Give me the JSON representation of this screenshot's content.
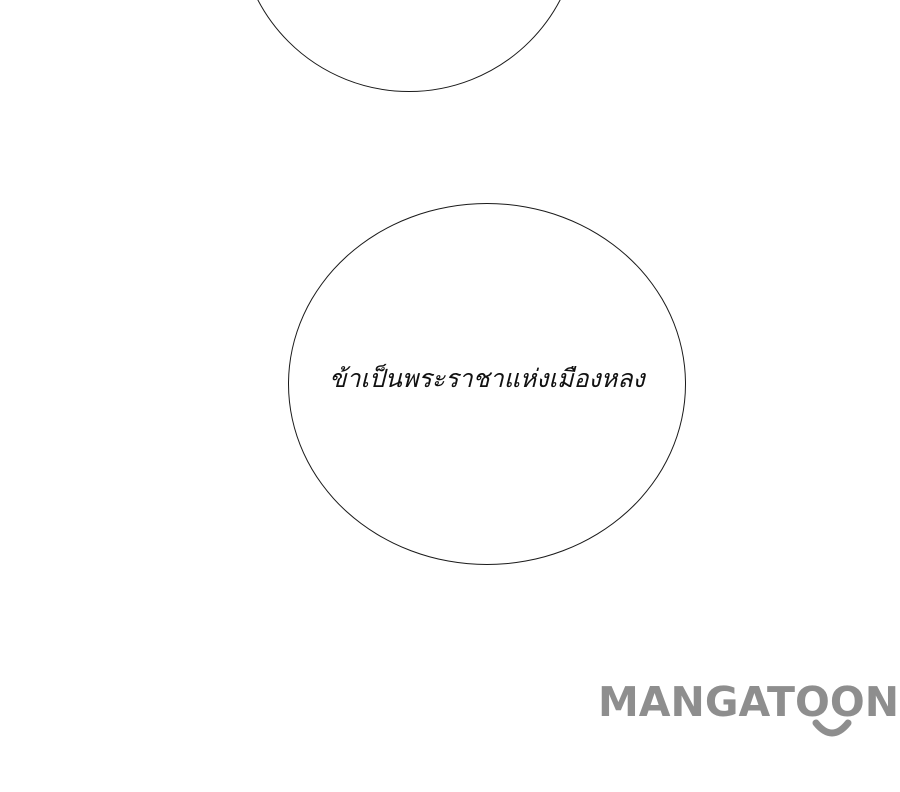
{
  "speech_balloons": [
    {
      "text": ""
    },
    {
      "text": "ข้าเป็นพระราชาแห่งเมืองหลง"
    }
  ],
  "watermark": {
    "text": "MANGATOON",
    "color": "#8e8e8e"
  }
}
